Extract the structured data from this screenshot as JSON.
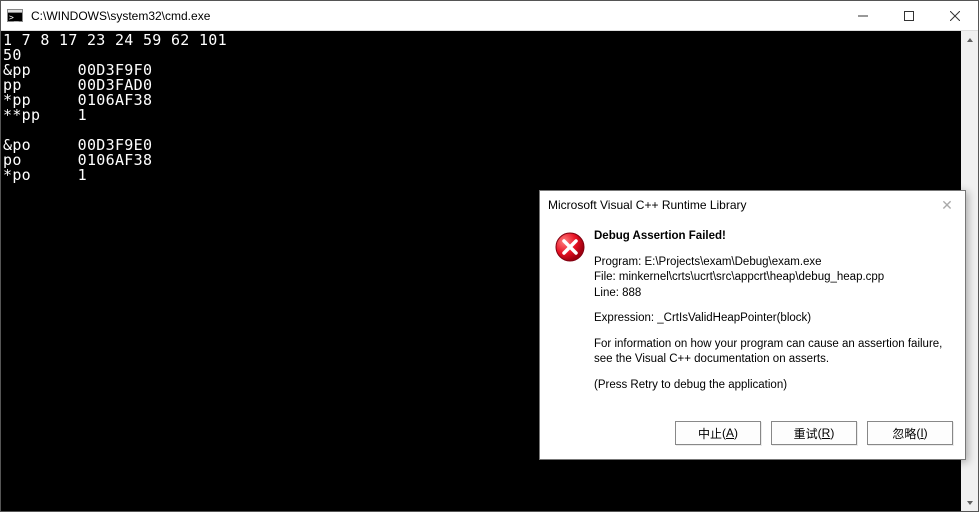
{
  "window": {
    "title": "C:\\WINDOWS\\system32\\cmd.exe"
  },
  "console": {
    "lines": [
      "1 7 8 17 23 24 59 62 101",
      "50",
      "&pp     00D3F9F0",
      "pp      00D3FAD0",
      "*pp     0106AF38",
      "**pp    1",
      "",
      "&po     00D3F9E0",
      "po      0106AF38",
      "*po     1"
    ]
  },
  "dialog": {
    "title": "Microsoft Visual C++ Runtime Library",
    "heading": "Debug Assertion Failed!",
    "program_label": "Program: ",
    "program": "E:\\Projects\\exam\\Debug\\exam.exe",
    "file_label": "File: ",
    "file": "minkernel\\crts\\ucrt\\src\\appcrt\\heap\\debug_heap.cpp",
    "line_label": "Line: ",
    "line_no": "888",
    "expr_label": "Expression: ",
    "expr": "_CrtIsValidHeapPointer(block)",
    "info": "For information on how your program can cause an assertion failure, see the Visual C++ documentation on asserts.",
    "retry_hint": "(Press Retry to debug the application)",
    "buttons": {
      "abort": "中止",
      "abort_key": "A",
      "retry": "重试",
      "retry_key": "R",
      "ignore": "忽略",
      "ignore_key": "I"
    }
  }
}
